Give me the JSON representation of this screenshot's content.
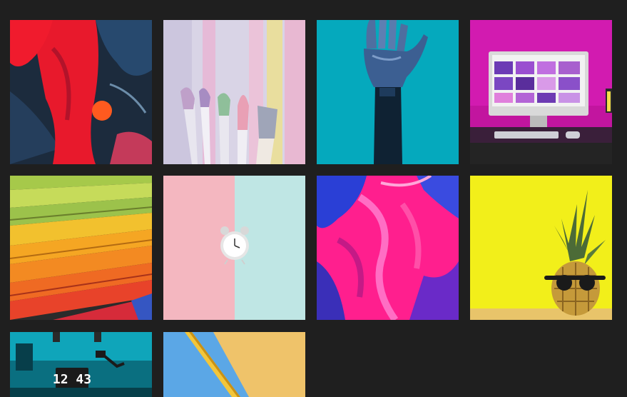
{
  "gallery": {
    "items": [
      {
        "name": "abstract-red-paint",
        "label": ""
      },
      {
        "name": "paint-brushes",
        "label": ""
      },
      {
        "name": "robot-hand",
        "label": ""
      },
      {
        "name": "imac-pink-desk",
        "label": ""
      },
      {
        "name": "rainbow-paper-stacks",
        "label": ""
      },
      {
        "name": "alarm-clock-pastel",
        "label": ""
      },
      {
        "name": "pink-blue-paint",
        "label": ""
      },
      {
        "name": "pineapple-sunglasses",
        "label": ""
      },
      {
        "name": "teal-desk-clock",
        "label": "12 43"
      },
      {
        "name": "pencil-on-paper",
        "label": ""
      }
    ]
  },
  "colors": {
    "background": "#1f1f1f"
  }
}
